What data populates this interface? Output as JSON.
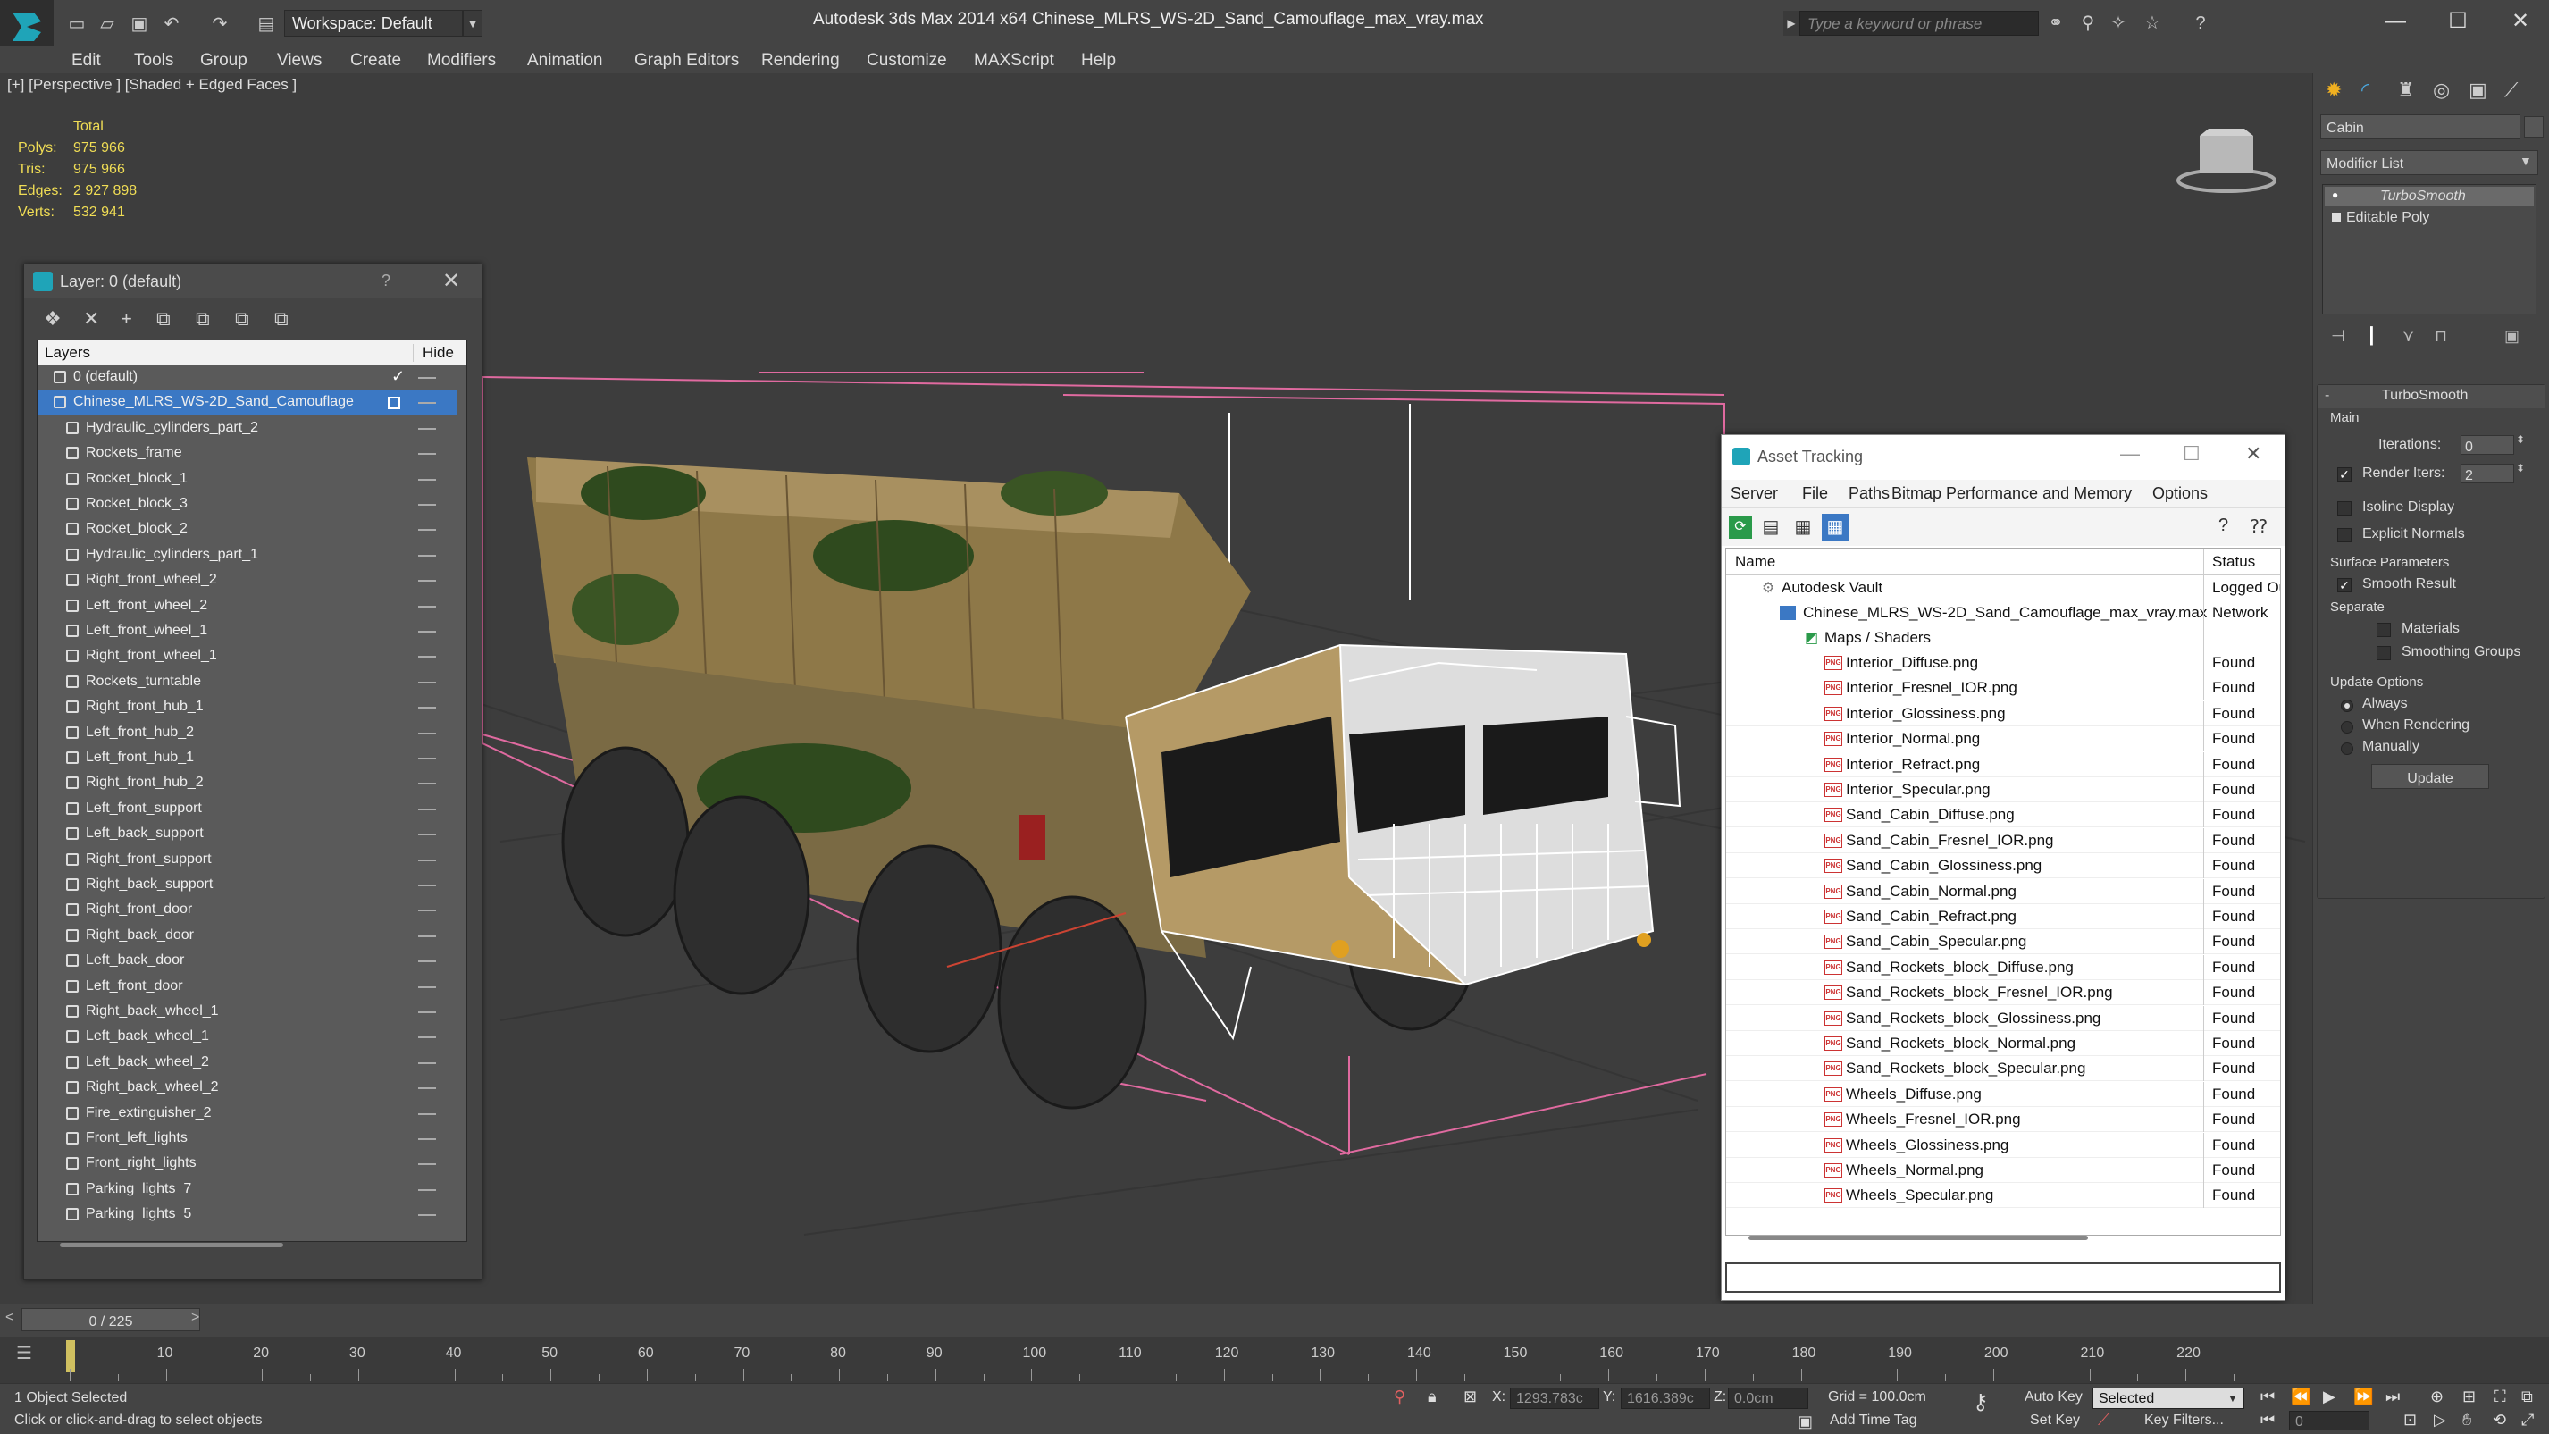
{
  "titlebar": {
    "workspace": "Workspace: Default",
    "app_title": "Autodesk 3ds Max  2014 x64      Chinese_MLRS_WS-2D_Sand_Camouflage_max_vray.max",
    "search_placeholder": "Type a keyword or phrase"
  },
  "menu": [
    "Edit",
    "Tools",
    "Group",
    "Views",
    "Create",
    "Modifiers",
    "Animation",
    "Graph Editors",
    "Rendering",
    "Customize",
    "MAXScript",
    "Help"
  ],
  "viewport": {
    "label": "[+] [Perspective ] [Shaded + Edged Faces ]",
    "stats": {
      "total": "Total",
      "polys_label": "Polys:",
      "polys": "975 966",
      "tris_label": "Tris:",
      "tris": "975 966",
      "edges_label": "Edges:",
      "edges": "2 927 898",
      "verts_label": "Verts:",
      "verts": "532 941"
    }
  },
  "layer_panel": {
    "title": "Layer: 0 (default)",
    "help": "?",
    "col_layers": "Layers",
    "col_hide": "Hide",
    "rows": [
      "0 (default)",
      "Chinese_MLRS_WS-2D_Sand_Camouflage",
      "Hydraulic_cylinders_part_2",
      "Rockets_frame",
      "Rocket_block_1",
      "Rocket_block_3",
      "Rocket_block_2",
      "Hydraulic_cylinders_part_1",
      "Right_front_wheel_2",
      "Left_front_wheel_2",
      "Left_front_wheel_1",
      "Right_front_wheel_1",
      "Rockets_turntable",
      "Right_front_hub_1",
      "Left_front_hub_2",
      "Left_front_hub_1",
      "Right_front_hub_2",
      "Left_front_support",
      "Left_back_support",
      "Right_front_support",
      "Right_back_support",
      "Right_front_door",
      "Right_back_door",
      "Left_back_door",
      "Left_front_door",
      "Right_back_wheel_1",
      "Left_back_wheel_1",
      "Left_back_wheel_2",
      "Right_back_wheel_2",
      "Fire_extinguisher_2",
      "Front_left_lights",
      "Front_right_lights",
      "Parking_lights_7",
      "Parking_lights_5"
    ]
  },
  "asset_tracking": {
    "title": "Asset Tracking",
    "menu": [
      "Server",
      "File",
      "Paths",
      "Bitmap Performance and Memory",
      "Options"
    ],
    "col_name": "Name",
    "col_status": "Status",
    "vault": {
      "name": "Autodesk Vault",
      "status": "Logged Out"
    },
    "file": {
      "name": "Chinese_MLRS_WS-2D_Sand_Camouflage_max_vray.max",
      "status": "Network"
    },
    "maps": "Maps / Shaders",
    "png_label": "PNG",
    "files": [
      {
        "name": "Interior_Diffuse.png",
        "status": "Found"
      },
      {
        "name": "Interior_Fresnel_IOR.png",
        "status": "Found"
      },
      {
        "name": "Interior_Glossiness.png",
        "status": "Found"
      },
      {
        "name": "Interior_Normal.png",
        "status": "Found"
      },
      {
        "name": "Interior_Refract.png",
        "status": "Found"
      },
      {
        "name": "Interior_Specular.png",
        "status": "Found"
      },
      {
        "name": "Sand_Cabin_Diffuse.png",
        "status": "Found"
      },
      {
        "name": "Sand_Cabin_Fresnel_IOR.png",
        "status": "Found"
      },
      {
        "name": "Sand_Cabin_Glossiness.png",
        "status": "Found"
      },
      {
        "name": "Sand_Cabin_Normal.png",
        "status": "Found"
      },
      {
        "name": "Sand_Cabin_Refract.png",
        "status": "Found"
      },
      {
        "name": "Sand_Cabin_Specular.png",
        "status": "Found"
      },
      {
        "name": "Sand_Rockets_block_Diffuse.png",
        "status": "Found"
      },
      {
        "name": "Sand_Rockets_block_Fresnel_IOR.png",
        "status": "Found"
      },
      {
        "name": "Sand_Rockets_block_Glossiness.png",
        "status": "Found"
      },
      {
        "name": "Sand_Rockets_block_Normal.png",
        "status": "Found"
      },
      {
        "name": "Sand_Rockets_block_Specular.png",
        "status": "Found"
      },
      {
        "name": "Wheels_Diffuse.png",
        "status": "Found"
      },
      {
        "name": "Wheels_Fresnel_IOR.png",
        "status": "Found"
      },
      {
        "name": "Wheels_Glossiness.png",
        "status": "Found"
      },
      {
        "name": "Wheels_Normal.png",
        "status": "Found"
      },
      {
        "name": "Wheels_Specular.png",
        "status": "Found"
      }
    ]
  },
  "command_panel": {
    "object_name": "Cabin",
    "modifier_list": "Modifier List",
    "stack": [
      "TurboSmooth",
      "Editable Poly"
    ],
    "rollout_title": "TurboSmooth",
    "main_label": "Main",
    "iterations_label": "Iterations:",
    "iterations": "0",
    "render_iters_label": "Render Iters:",
    "render_iters": "2",
    "isoline": "Isoline Display",
    "explicit_normals": "Explicit Normals",
    "surface_params": "Surface Parameters",
    "smooth_result": "Smooth Result",
    "separate": "Separate",
    "materials": "Materials",
    "smoothing_groups": "Smoothing Groups",
    "update_options": "Update Options",
    "always": "Always",
    "when_rendering": "When Rendering",
    "manually": "Manually",
    "update_btn": "Update"
  },
  "timeline": {
    "frame": "0 / 225",
    "ticks": [
      "10",
      "20",
      "30",
      "40",
      "50",
      "60",
      "70",
      "80",
      "90",
      "100",
      "110",
      "120",
      "130",
      "140",
      "150",
      "160",
      "170",
      "180",
      "190",
      "200",
      "210",
      "220"
    ]
  },
  "status": {
    "selected": "1 Object Selected",
    "hint": "Click or click-and-drag to select objects",
    "x_label": "X:",
    "x": "1293.783c",
    "y_label": "Y:",
    "y": "1616.389c",
    "z_label": "Z:",
    "z": "0.0cm",
    "grid": "Grid = 100.0cm",
    "auto_key": "Auto Key",
    "selected_dd": "Selected",
    "set_key": "Set Key",
    "key_filters": "Key Filters...",
    "add_time_tag": "Add Time Tag",
    "frame_field": "0"
  },
  "colors": {
    "selection": "#3b78c4",
    "wire_pink": "#e06aa0",
    "stats": "#f0dd55",
    "camo_sand": "#9c8452",
    "camo_green": "#2f4a1e"
  }
}
